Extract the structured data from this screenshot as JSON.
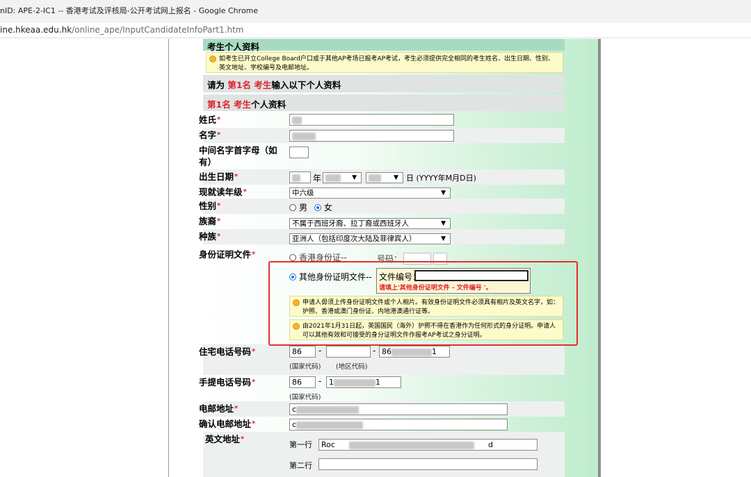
{
  "window": {
    "title": "nID: APE-2-IC1 -- 香港考试及评核局-公开考试网上报名 - Google Chrome",
    "url_host": "ine.hkeaa.edu.hk",
    "url_path": "/online_ape/InputCandidateInfoPart1.htm"
  },
  "form": {
    "section_title": "考生个人资料",
    "notice": "如考生已开立College Board户口或于其他AP考场已报考AP考试，考生必须提供完全相同的考生姓名、出生日期、性别、英文地址、学校编号及电邮地址。",
    "prompt_prefix": "请为 ",
    "prompt_highlight": "第1名 考生",
    "prompt_suffix": "输入以下个人资料",
    "subheader_highlight": "第1名 考生",
    "subheader_suffix": "个人资料",
    "required_mark": "*",
    "labels": {
      "surname": "姓氏",
      "given_name": "名字",
      "middle_initial": "中间名字首字母（如有）",
      "dob": "出生日期",
      "grade": "现就读年级",
      "gender": "性别",
      "ethnicity": "族裔",
      "race": "种族",
      "id_doc": "身份证明文件",
      "home_phone": "住宅电话号码",
      "mobile_phone": "手提电话号码",
      "email": "电邮地址",
      "confirm_email": "确认电邮地址",
      "address": "英文地址"
    },
    "dob": {
      "year_suffix": "年",
      "day_suffix": "日 (YYYY年M月D日)"
    },
    "grade_value": "中六级",
    "gender": {
      "male": "男",
      "female": "女",
      "selected": "female"
    },
    "ethnicity_value": "不属于西班牙裔、拉丁裔或西班牙人",
    "race_value": "亚洲人（包括印度次大陆及菲律宾人）",
    "id_doc": {
      "hkid_label": "香港身份证--",
      "number_label": "号码：",
      "other_label": "其他身份证明文件--",
      "doc_number_label": "文件编号：",
      "error": "请填上'其他身份证明文件 - 文件编号 '。",
      "note1": "申请人毋须上传身份证明文件或个人相片。有效身份证明文件必须具有相片及英文名字，如：护照、香港或澳门身份证、内地港澳通行证等。",
      "note2": "由2021年1月31日起，英国国民（海外）护照不得在香港作为任何形式的身分证明。申请人可以其他有效和可接受的身分证明文件作报考AP考试之身分证明。"
    },
    "phone": {
      "country_code": "86",
      "dash": "-",
      "area_prefix": "86",
      "home_tail": "1",
      "mobile_prefix": "1",
      "mobile_tail": "1",
      "country_caption": "(国家代码)",
      "area_caption": "(地区代码)"
    },
    "email_value": "c",
    "confirm_email_value": "c",
    "address": {
      "line1_label": "第一行",
      "line1_value": "Roc",
      "line1_tail": "d",
      "line2_label": "第二行"
    }
  }
}
